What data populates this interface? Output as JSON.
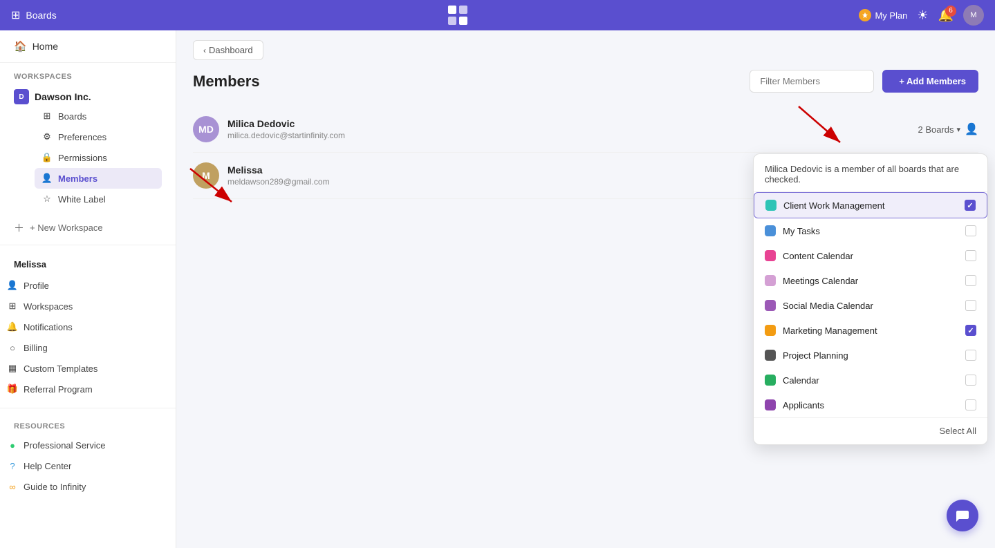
{
  "topnav": {
    "boards_label": "Boards",
    "plan_label": "My Plan",
    "notif_count": "6",
    "sun_icon": "☀",
    "bell_icon": "🔔"
  },
  "sidebar": {
    "home_label": "Home",
    "workspaces_section": "Workspaces",
    "workspace_name": "Dawson Inc.",
    "workspace_initial": "D",
    "subitems": [
      {
        "id": "boards",
        "label": "Boards",
        "icon": "boards"
      },
      {
        "id": "preferences",
        "label": "Preferences",
        "icon": "preferences"
      },
      {
        "id": "permissions",
        "label": "Permissions",
        "icon": "permissions"
      },
      {
        "id": "members",
        "label": "Members",
        "icon": "members",
        "active": true
      },
      {
        "id": "whitelabel",
        "label": "White Label",
        "icon": "whitelabel"
      }
    ],
    "new_workspace_label": "+ New Workspace",
    "user_section_name": "Melissa",
    "user_items": [
      {
        "id": "profile",
        "label": "Profile",
        "icon": "person"
      },
      {
        "id": "workspaces",
        "label": "Workspaces",
        "icon": "grid"
      },
      {
        "id": "notifications",
        "label": "Notifications",
        "icon": "bell"
      },
      {
        "id": "billing",
        "label": "Billing",
        "icon": "circle"
      },
      {
        "id": "custom-templates",
        "label": "Custom Templates",
        "icon": "layout"
      },
      {
        "id": "referral",
        "label": "Referral Program",
        "icon": "gift"
      }
    ],
    "resources_section": "Resources",
    "resources_items": [
      {
        "id": "professional",
        "label": "Professional Service",
        "icon": "pro"
      },
      {
        "id": "help",
        "label": "Help Center",
        "icon": "help"
      },
      {
        "id": "guide",
        "label": "Guide to Infinity",
        "icon": "guide"
      }
    ]
  },
  "breadcrumb": {
    "label": "Dashboard"
  },
  "members": {
    "title": "Members",
    "filter_placeholder": "Filter Members",
    "add_label": "+ Add  Members",
    "list": [
      {
        "id": "milica",
        "name": "Milica Dedovic",
        "email": "milica.dedovic@startinfinity.com",
        "boards_count": "2 Boards",
        "avatar_bg": "#a892d4",
        "avatar_initials": "MD"
      },
      {
        "id": "melissa",
        "name": "Melissa",
        "email": "meldawson289@gmail.com",
        "boards_count": "—",
        "avatar_bg": "#c0a878",
        "avatar_initials": "M"
      }
    ]
  },
  "boards_popup": {
    "description": "Milica Dedovic is a member of all boards that are checked.",
    "boards": [
      {
        "id": "cwm",
        "label": "Client Work Management",
        "color": "#2ec4b6",
        "checked": true,
        "highlighted": true
      },
      {
        "id": "mytasks",
        "label": "My Tasks",
        "color": "#4a90d9",
        "checked": false,
        "highlighted": false
      },
      {
        "id": "content",
        "label": "Content Calendar",
        "color": "#e84393",
        "checked": false,
        "highlighted": false
      },
      {
        "id": "meetings",
        "label": "Meetings Calendar",
        "color": "#d4a0d4",
        "checked": false,
        "highlighted": false
      },
      {
        "id": "social",
        "label": "Social Media Calendar",
        "color": "#9b59b6",
        "checked": false,
        "highlighted": false
      },
      {
        "id": "marketing",
        "label": "Marketing Management",
        "color": "#f39c12",
        "checked": true,
        "highlighted": false
      },
      {
        "id": "project",
        "label": "Project Planning",
        "color": "#555",
        "checked": false,
        "highlighted": false
      },
      {
        "id": "calendar",
        "label": "Calendar",
        "color": "#27ae60",
        "checked": false,
        "highlighted": false
      },
      {
        "id": "applicants",
        "label": "Applicants",
        "color": "#8e44ad",
        "checked": false,
        "highlighted": false
      }
    ],
    "select_all_label": "Select All"
  }
}
